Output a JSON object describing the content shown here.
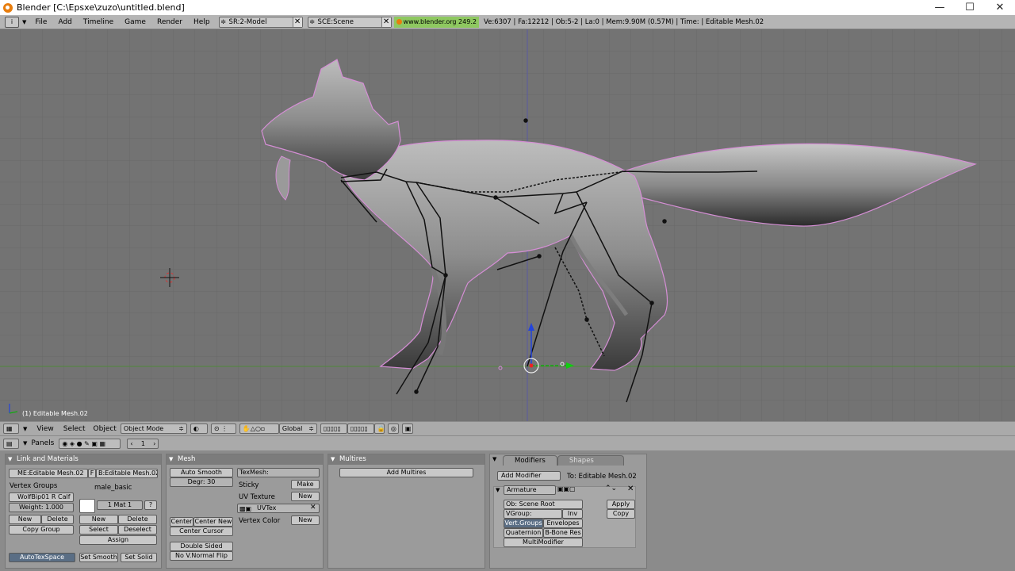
{
  "window": {
    "title": "Blender [C:\\Epsxe\\zuzo\\untitled.blend]",
    "min": "—",
    "max": "☐",
    "close": "✕"
  },
  "menubar": {
    "items": [
      "File",
      "Add",
      "Timeline",
      "Game",
      "Render",
      "Help"
    ],
    "screen": "SR:2-Model",
    "scene": "SCE:Scene",
    "website": "www.blender.org 249.2",
    "stats": "Ve:6307 | Fa:12212 | Ob:5-2 | La:0  | Mem:9.90M (0.57M) | Time: | Editable Mesh.02"
  },
  "viewport": {
    "object_label": "(1) Editable Mesh.02"
  },
  "header3d": {
    "menus": [
      "View",
      "Select",
      "Object"
    ],
    "mode": "Object Mode",
    "orientation": "Global"
  },
  "panelsbar": {
    "label": "Panels",
    "frame": "1"
  },
  "link_materials": {
    "title": "Link and Materials",
    "me": "ME:Editable Mesh.02",
    "f": "F",
    "ob": "B:Editable Mesh.02",
    "vgroups_label": "Vertex Groups",
    "material_name": "male_basic",
    "vgroup": "WolfBip01 R Calf",
    "weight": "Weight: 1.000",
    "mat": "1 Mat 1",
    "question": "?",
    "new1": "New",
    "delete1": "Delete",
    "copy_group": "Copy Group",
    "new2": "New",
    "delete2": "Delete",
    "select": "Select",
    "deselect": "Deselect",
    "assign": "Assign",
    "autotexspace": "AutoTexSpace",
    "set_smooth": "Set Smooth",
    "set_solid": "Set Solid"
  },
  "mesh": {
    "title": "Mesh",
    "auto_smooth": "Auto Smooth",
    "degr": "Degr: 30",
    "center": "Center",
    "center_new": "Center New",
    "center_cursor": "Center Cursor",
    "double_sided": "Double Sided",
    "no_vnormal_flip": "No V.Normal Flip",
    "texmesh": "TexMesh:",
    "sticky": "Sticky",
    "make": "Make",
    "uv_texture": "UV Texture",
    "new_uv": "New",
    "uvtex": "UVTex",
    "vertex_color": "Vertex Color",
    "new_vc": "New"
  },
  "multires": {
    "title": "Multires",
    "add": "Add Multires"
  },
  "modifiers": {
    "tab1": "Modifiers",
    "tab2": "Shapes",
    "add": "Add Modifier",
    "to": "To: Editable Mesh.02",
    "mod_name": "Armature",
    "apply": "Apply",
    "copy": "Copy",
    "ob": "Ob: Scene Root",
    "vgroup": "VGroup:",
    "inv": "Inv",
    "vert_groups": "Vert.Groups",
    "envelopes": "Envelopes",
    "quaternion": "Quaternion",
    "bbone": "B-Bone Res",
    "multi": "MultiModifier"
  }
}
